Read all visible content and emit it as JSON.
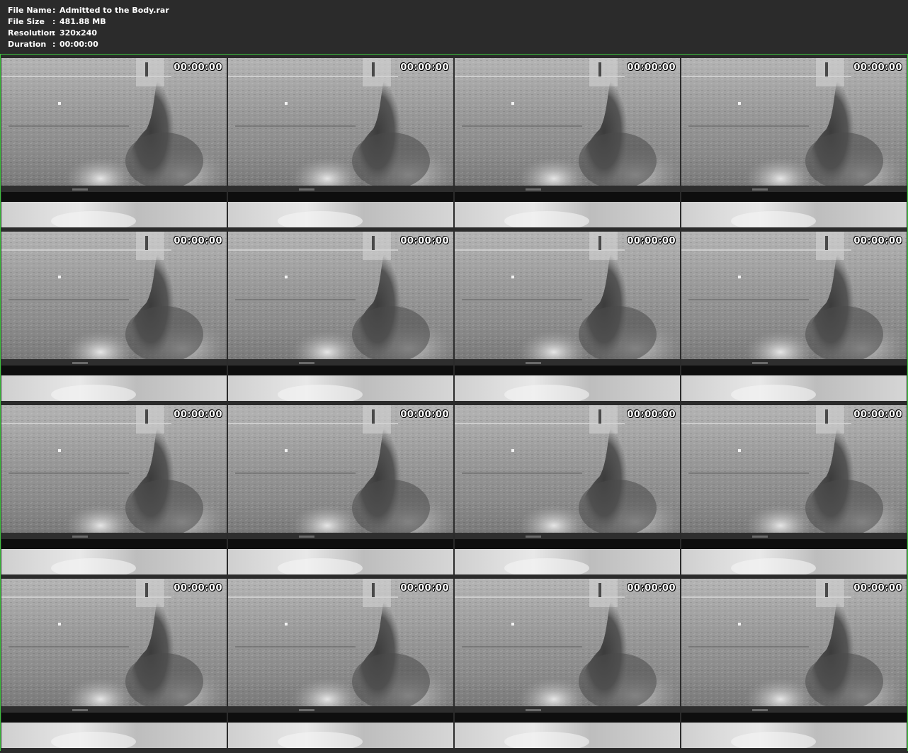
{
  "info": {
    "rows": [
      {
        "label": "File Name",
        "sep": ":",
        "value": "Admitted to the Body.rar"
      },
      {
        "label": "File Size",
        "sep": ":",
        "value": "481.88 MB"
      },
      {
        "label": "Resolution",
        "sep": ":",
        "value": "320x240"
      },
      {
        "label": "Duration",
        "sep": ":",
        "value": "00:00:00"
      }
    ]
  },
  "grid": {
    "columns": 4,
    "rows": 4,
    "frame_border_color": "#3ec43e",
    "timestamps": [
      "00:00:00",
      "00:00:00",
      "00:00:00",
      "00:00:00",
      "00:00:00",
      "00:00:00",
      "00:00:00",
      "00:00:00",
      "00:00:00",
      "00:00:00",
      "00:00:00",
      "00:00:00",
      "00:00:00",
      "00:00:00",
      "00:00:00",
      "00:00:00"
    ]
  }
}
